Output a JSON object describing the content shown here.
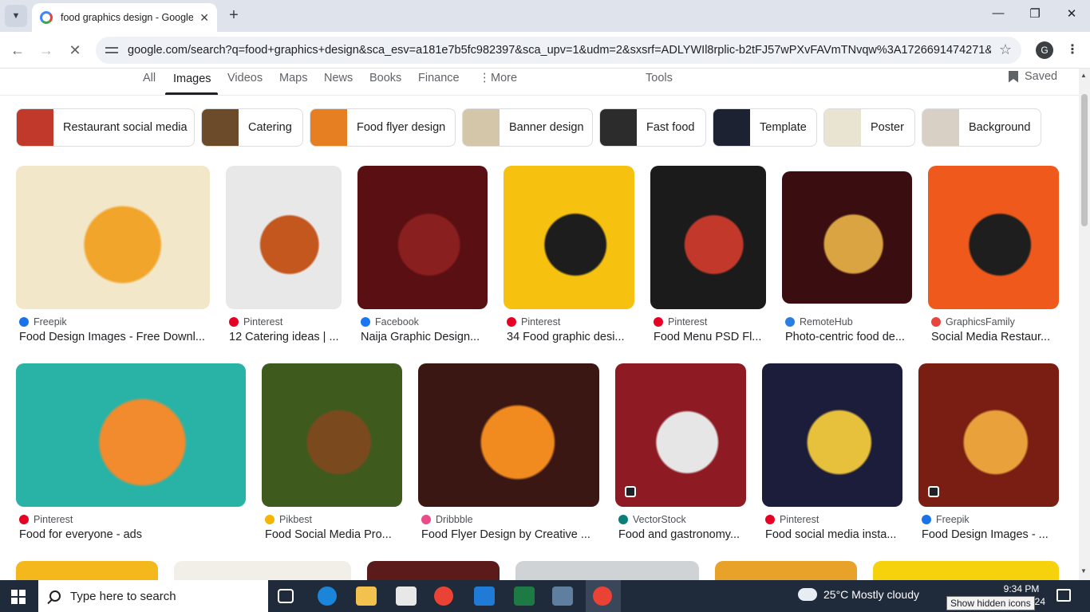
{
  "browser": {
    "tab_title": "food graphics design - Google Search",
    "url": "google.com/search?q=food+graphics+design&sca_esv=a181e7b5fc982397&sca_upv=1&udm=2&sxsrf=ADLYWIl8rplic-b2tFJ57wPXvFAVmTNvqw%3A1726691474271&ei=kjj...",
    "profile_initial": "G"
  },
  "search_tabs": [
    {
      "label": "All"
    },
    {
      "label": "Images"
    },
    {
      "label": "Videos"
    },
    {
      "label": "Maps"
    },
    {
      "label": "News"
    },
    {
      "label": "Books"
    },
    {
      "label": "Finance"
    },
    {
      "label": "More"
    }
  ],
  "tools_label": "Tools",
  "saved_label": "Saved",
  "chips": [
    {
      "label": "Restaurant social media",
      "color": "#c0392b"
    },
    {
      "label": "Catering",
      "color": "#6b4b2a"
    },
    {
      "label": "Food flyer design",
      "color": "#e67e22"
    },
    {
      "label": "Banner design",
      "color": "#d4c6a8"
    },
    {
      "label": "Fast food",
      "color": "#2c2c2c"
    },
    {
      "label": "Template",
      "color": "#1d2233"
    },
    {
      "label": "Poster",
      "color": "#e9e3d2"
    },
    {
      "label": "Background",
      "color": "#d8d0c4"
    }
  ],
  "results": [
    {
      "source": "Freepik",
      "title": "Food Design Images - Free Downl...",
      "source_color": "#1a73e8",
      "bg": "#f3e7c9",
      "accent": "#f2a52b"
    },
    {
      "source": "Pinterest",
      "title": "12 Catering ideas | ...",
      "source_color": "#e60023",
      "bg": "#e8e8e8",
      "accent": "#c4571e"
    },
    {
      "source": "Facebook",
      "title": "Naija Graphic Design...",
      "source_color": "#1877f2",
      "bg": "#5a0f12",
      "accent": "#8a1f1f"
    },
    {
      "source": "Pinterest",
      "title": "34 Food graphic desi...",
      "source_color": "#e60023",
      "bg": "#f6c20f",
      "accent": "#1d1d1d"
    },
    {
      "source": "Pinterest",
      "title": "Food Menu PSD Fl...",
      "source_color": "#e60023",
      "bg": "#1b1b1b",
      "accent": "#c2392b"
    },
    {
      "source": "RemoteHub",
      "title": "Photo-centric food de...",
      "source_color": "#2a7de1",
      "bg": "#3a0d10",
      "accent": "#d9a441"
    },
    {
      "source": "GraphicsFamily",
      "title": "Social Media Restaur...",
      "source_color": "#e8453c",
      "bg": "#ef5a1c",
      "accent": "#1e1e1e"
    },
    {
      "source": "Pinterest",
      "title": "Food for everyone - ads",
      "source_color": "#e60023",
      "bg": "#29b3a6",
      "accent": "#f28a2e"
    },
    {
      "source": "Pikbest",
      "title": "Food Social Media Pro...",
      "source_color": "#f4b400",
      "bg": "#3f5a1d",
      "accent": "#7a4a1e"
    },
    {
      "source": "Dribbble",
      "title": "Food Flyer Design by Creative ...",
      "source_color": "#ea4c89",
      "bg": "#3b1713",
      "accent": "#f28b1f"
    },
    {
      "source": "VectorStock",
      "title": "Food and gastronomy...",
      "source_color": "#0a7f7a",
      "bg": "#8e1a24",
      "accent": "#e6e6e6"
    },
    {
      "source": "Pinterest",
      "title": "Food social media insta...",
      "source_color": "#e60023",
      "bg": "#1c1d3a",
      "accent": "#e7c13b"
    },
    {
      "source": "Freepik",
      "title": "Food Design Images - ...",
      "source_color": "#1a73e8",
      "bg": "#7a1d12",
      "accent": "#e9a23b"
    }
  ],
  "partial_row_colors": [
    "#f5b81c",
    "#f2efe9",
    "#5b1b1b",
    "#cfd3d6",
    "#e8a22a",
    "#f5d20c"
  ],
  "taskbar": {
    "search_placeholder": "Type here to search",
    "weather": "25°C  Mostly cloudy",
    "time": "9:34 PM",
    "date_fragment": "24",
    "tooltip": "Show hidden icons"
  }
}
